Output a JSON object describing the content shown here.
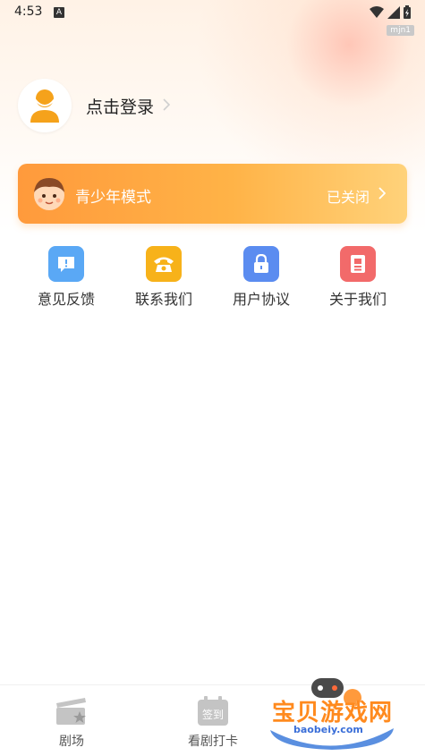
{
  "status_bar": {
    "time": "4:53",
    "a_icon": "A",
    "tag": "mjn1"
  },
  "profile": {
    "login_label": "点击登录"
  },
  "teen_mode": {
    "label": "青少年模式",
    "status": "已关闭"
  },
  "menu": {
    "items": [
      {
        "label": "意见反馈",
        "icon": "feedback-icon",
        "color": "#5aa8f5"
      },
      {
        "label": "联系我们",
        "icon": "phone-icon",
        "color": "#f7b21a"
      },
      {
        "label": "用户协议",
        "icon": "lock-icon",
        "color": "#5b8cf0"
      },
      {
        "label": "关于我们",
        "icon": "about-icon",
        "color": "#f26a6a"
      }
    ]
  },
  "tabbar": {
    "tabs": [
      {
        "label": "剧场",
        "icon": "clapperboard-icon"
      },
      {
        "label": "看剧打卡",
        "icon": "calendar-checkin-icon",
        "icon_text": "签到"
      }
    ]
  },
  "watermark": {
    "text": "宝贝游戏网",
    "url": "baobeiy.com"
  },
  "colors": {
    "accent": "#ff9a3c",
    "avatar": "#f5a21b"
  }
}
